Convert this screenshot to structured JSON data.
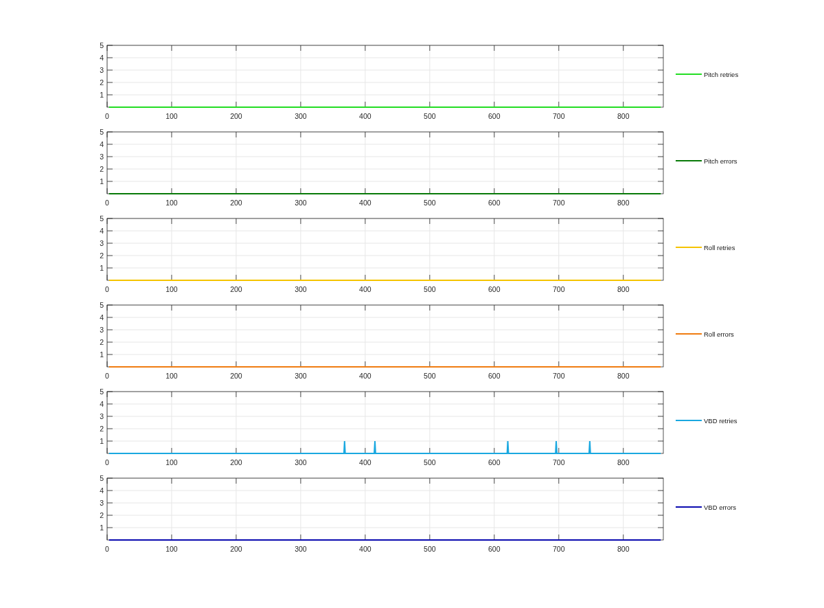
{
  "charts": [
    {
      "chart_data": {
        "type": "line",
        "x": [
          3,
          858
        ],
        "series": [
          {
            "name": "Pitch retries",
            "color": "#22dd22",
            "values": [
              0,
              0
            ]
          }
        ],
        "xlim": [
          0,
          862
        ],
        "ylim": [
          0,
          5
        ],
        "xticks": [
          0,
          100,
          200,
          300,
          400,
          500,
          600,
          700,
          800
        ],
        "yticks": [
          1,
          2,
          3,
          4,
          5
        ],
        "grid": true
      }
    },
    {
      "chart_data": {
        "type": "line",
        "x": [
          3,
          858
        ],
        "series": [
          {
            "name": "Pitch errors",
            "color": "#087a08",
            "values": [
              0,
              0
            ]
          }
        ],
        "xlim": [
          0,
          862
        ],
        "ylim": [
          0,
          5
        ],
        "xticks": [
          0,
          100,
          200,
          300,
          400,
          500,
          600,
          700,
          800
        ],
        "yticks": [
          1,
          2,
          3,
          4,
          5
        ],
        "grid": true
      }
    },
    {
      "chart_data": {
        "type": "line",
        "x": [
          3,
          858
        ],
        "series": [
          {
            "name": "Roll retries",
            "color": "#f5c400",
            "values": [
              0,
              0
            ]
          }
        ],
        "xlim": [
          0,
          862
        ],
        "ylim": [
          0,
          5
        ],
        "xticks": [
          0,
          100,
          200,
          300,
          400,
          500,
          600,
          700,
          800
        ],
        "yticks": [
          1,
          2,
          3,
          4,
          5
        ],
        "grid": true
      }
    },
    {
      "chart_data": {
        "type": "line",
        "x": [
          3,
          858
        ],
        "series": [
          {
            "name": "Roll errors",
            "color": "#f07c10",
            "values": [
              0,
              0
            ]
          }
        ],
        "xlim": [
          0,
          862
        ],
        "ylim": [
          0,
          5
        ],
        "xticks": [
          0,
          100,
          200,
          300,
          400,
          500,
          600,
          700,
          800
        ],
        "yticks": [
          1,
          2,
          3,
          4,
          5
        ],
        "grid": true
      }
    },
    {
      "chart_data": {
        "type": "line",
        "x": [
          3,
          367,
          368,
          369,
          414,
          415,
          416,
          620,
          621,
          622,
          695,
          696,
          697,
          747,
          748,
          749,
          858
        ],
        "series": [
          {
            "name": "VBD retries",
            "color": "#1aa8e0",
            "values": [
              0,
              0,
              1,
              0,
              0,
              1,
              0,
              0,
              1,
              0,
              0,
              1,
              0,
              0,
              1,
              0,
              0
            ]
          }
        ],
        "xlim": [
          0,
          862
        ],
        "ylim": [
          0,
          5
        ],
        "xticks": [
          0,
          100,
          200,
          300,
          400,
          500,
          600,
          700,
          800
        ],
        "yticks": [
          1,
          2,
          3,
          4,
          5
        ],
        "grid": true
      }
    },
    {
      "chart_data": {
        "type": "line",
        "x": [
          3,
          858
        ],
        "series": [
          {
            "name": "VBD errors",
            "color": "#0a0ab0",
            "values": [
              0,
              0
            ]
          }
        ],
        "xlim": [
          0,
          862
        ],
        "ylim": [
          0,
          5
        ],
        "xticks": [
          0,
          100,
          200,
          300,
          400,
          500,
          600,
          700,
          800
        ],
        "yticks": [
          1,
          2,
          3,
          4,
          5
        ],
        "grid": true
      }
    }
  ]
}
